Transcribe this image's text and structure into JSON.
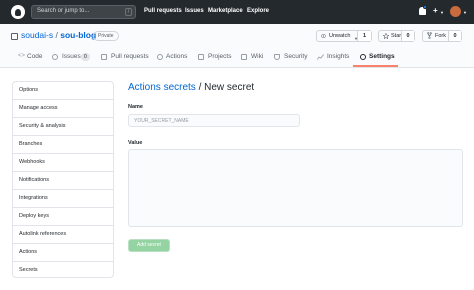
{
  "header": {
    "search_placeholder": "Search or jump to...",
    "search_shortcut": "/",
    "nav": [
      "Pull requests",
      "Issues",
      "Marketplace",
      "Explore"
    ],
    "icons": [
      "github-logo-icon",
      "bell-icon",
      "plus-icon",
      "avatar"
    ]
  },
  "repo": {
    "owner": "soudai-s",
    "separator": "/",
    "name": "sou-blog",
    "visibility": "Private",
    "buttons": {
      "watch_label": "Unwatch",
      "watch_count": "1",
      "star_label": "Star",
      "star_count": "0",
      "fork_label": "Fork",
      "fork_count": "0"
    },
    "tabs": {
      "code": "Code",
      "issues": "Issues",
      "issues_count": "0",
      "pulls": "Pull requests",
      "actions": "Actions",
      "projects": "Projects",
      "wiki": "Wiki",
      "security": "Security",
      "insights": "Insights",
      "settings": "Settings"
    },
    "active_tab": "settings"
  },
  "sidebar": {
    "items": [
      "Options",
      "Manage access",
      "Security & analysis",
      "Branches",
      "Webhooks",
      "Notifications",
      "Integrations",
      "Deploy keys",
      "Autolink references",
      "Actions",
      "Secrets"
    ]
  },
  "form": {
    "title_link": "Actions secrets",
    "title_rest": " / New secret",
    "name_label": "Name",
    "name_placeholder": "YOUR_SECRET_NAME",
    "value_label": "Value",
    "submit_label": "Add secret"
  },
  "colors": {
    "header_bg": "#24292e",
    "link": "#0366d6",
    "active_tab_underline": "#f9826c",
    "submit_disabled": "#94d3a2"
  }
}
